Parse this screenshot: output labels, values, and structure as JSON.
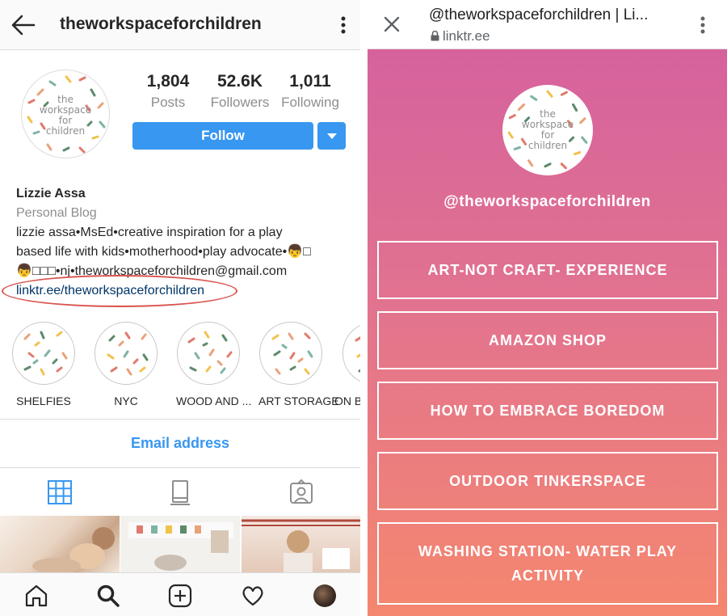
{
  "instagram": {
    "header": {
      "username": "theworkspaceforchildren"
    },
    "avatar_text": [
      "the",
      "workspace",
      "for",
      "children"
    ],
    "stats": [
      {
        "value": "1,804",
        "label": "Posts"
      },
      {
        "value": "52.6K",
        "label": "Followers"
      },
      {
        "value": "1,011",
        "label": "Following"
      }
    ],
    "follow_label": "Follow",
    "bio": {
      "name": "Lizzie Assa",
      "category": "Personal Blog",
      "line1": "lizzie assa•MsEd•creative inspiration for a play",
      "line2": "based life with kids•motherhood•play advocate•",
      "line3": "nj•theworkspaceforchildren@gmail.com",
      "link": "linktr.ee/theworkspaceforchildren"
    },
    "highlights": [
      "SHELFIES",
      "NYC",
      "WOOD AND ...",
      "ART STORAGE",
      "ON B"
    ],
    "email_label": "Email address"
  },
  "linktree": {
    "page_title": "@theworkspaceforchildren | Li...",
    "url": "linktr.ee",
    "avatar_text": [
      "the",
      "workspace",
      "for",
      "children"
    ],
    "handle": "@theworkspaceforchildren",
    "links": [
      "ART-NOT CRAFT- EXPERIENCE",
      "AMAZON SHOP",
      "HOW TO EMBRACE BOREDOM",
      "OUTDOOR TINKERSPACE",
      "WASHING STATION- WATER PLAY ACTIVITY"
    ]
  },
  "colors": {
    "instagram_blue": "#3897f0",
    "link_blue": "#003569",
    "annotation_red": "#d9534f",
    "linktree_gradient_top": "#d6629d",
    "linktree_gradient_bottom": "#f5876f"
  },
  "icons": [
    "back-arrow-icon",
    "kebab-menu-icon",
    "dropdown-triangle-icon",
    "grid-icon",
    "igtv-icon",
    "tagged-icon",
    "home-icon",
    "search-icon",
    "add-post-icon",
    "heart-icon",
    "close-icon",
    "lock-icon"
  ]
}
